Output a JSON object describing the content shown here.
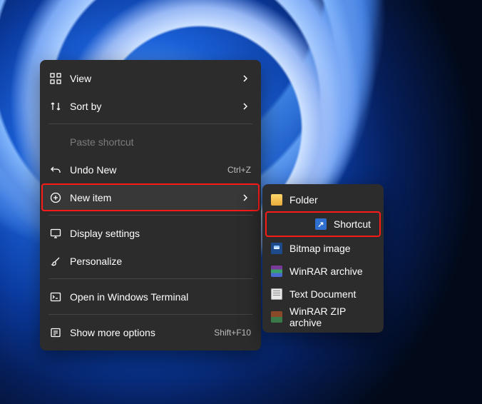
{
  "main_menu": {
    "view": "View",
    "sort_by": "Sort by",
    "paste_shortcut": "Paste shortcut",
    "undo_new": "Undo New",
    "undo_shortcut": "Ctrl+Z",
    "new_item": "New item",
    "display_settings": "Display settings",
    "personalize": "Personalize",
    "open_terminal": "Open in Windows Terminal",
    "show_more": "Show more options",
    "show_more_shortcut": "Shift+F10"
  },
  "sub_menu": {
    "folder": "Folder",
    "shortcut": "Shortcut",
    "bitmap": "Bitmap image",
    "rar": "WinRAR archive",
    "txt": "Text Document",
    "zip": "WinRAR ZIP archive"
  }
}
